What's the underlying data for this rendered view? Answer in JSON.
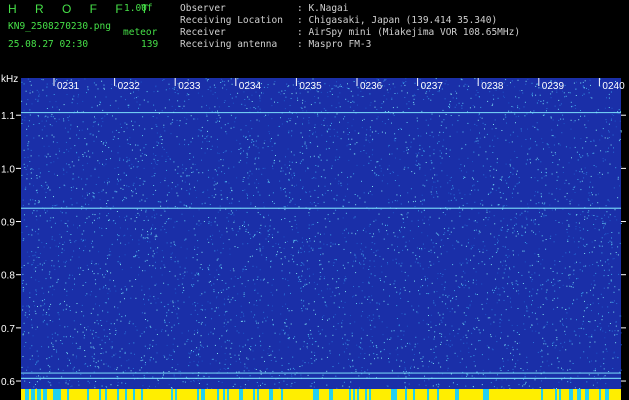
{
  "header": {
    "program": "H R O F F T",
    "version": "1.00f",
    "filename": "KN9_2508270230.png",
    "datetime": "25.08.27 02:30",
    "meteor_label": "meteor",
    "meteor_count": "139",
    "observer_label": "Observer",
    "observer_value": ": K.Nagai",
    "location_label": "Receiving Location",
    "location_value": ": Chigasaki, Japan (139.414 35.340)",
    "receiver_label": "Receiver",
    "receiver_value": ": AirSpy mini (Miakejima VOR 108.65MHz)",
    "antenna_label": "Receiving antenna",
    "antenna_value": ": Maspro FM-3"
  },
  "chart_data": {
    "type": "heatmap",
    "ylabel": "kHz",
    "x_ticks": [
      "0231",
      "0232",
      "0233",
      "0234",
      "0235",
      "0236",
      "0237",
      "0238",
      "0239",
      "0240"
    ],
    "y_ticks": [
      1.1,
      1.0,
      0.9,
      0.8,
      0.7,
      0.6
    ],
    "ylim": [
      0.585,
      1.17
    ],
    "xlim_minutes": [
      0,
      10
    ],
    "horizontal_carrier_lines_khz": [
      1.105,
      0.925,
      0.615,
      0.605
    ],
    "colors": {
      "background": "#1a2fa8",
      "noise": "#3aa0e8",
      "line": "#7fe6ff",
      "bottom_bar": "#ffee00"
    }
  }
}
